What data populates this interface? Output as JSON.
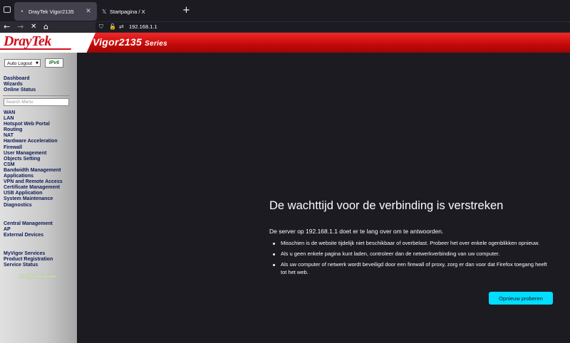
{
  "browser": {
    "tabs": [
      {
        "title": "DrayTek Vigor2135",
        "favicon": "dot-icon",
        "active": true
      },
      {
        "title": "Startpagina / X",
        "favicon": "x-logo-icon",
        "active": false
      }
    ],
    "url": "192.168.1.1"
  },
  "router": {
    "brand": "DrayTek",
    "model": "Vigor2135",
    "series": "Series",
    "auto_logout": "Auto Logout",
    "ipv6_badge": "IPv6",
    "search_placeholder": "Search Menu",
    "menu_top": [
      "Dashboard",
      "Wizards",
      "Online Status"
    ],
    "menu_main": [
      "WAN",
      "LAN",
      "Hotspot Web Portal",
      "Routing",
      "NAT",
      "Hardware Acceleration",
      "Firewall",
      "User Management",
      "Objects Setting",
      "CSM",
      "Bandwidth Management",
      "Applications",
      "VPN and Remote Access",
      "Certificate Management",
      "USB Application",
      "System Maintenance",
      "Diagnostics"
    ],
    "menu_central": [
      "Central Management",
      "AP",
      "External Devices"
    ],
    "menu_myvigor": [
      "MyVigor Services",
      "Product Registration",
      "Service Status"
    ],
    "rights": "All Rights Reserved."
  },
  "error": {
    "title": "De wachttijd voor de verbinding is verstreken",
    "lead": "De server op 192.168.1.1 doet er te lang over om te antwoorden.",
    "bullets": [
      "Misschien is de website tijdelijk niet beschikbaar of overbelast. Probeer het over enkele ogenblikken opnieuw.",
      "Als u geen enkele pagina kunt laden, controleer dan de netwerkverbinding van uw computer.",
      "Als uw computer of netwerk wordt beveiligd door een firewall of proxy, zorg er dan voor dat Firefox toegang heeft tot het web."
    ],
    "retry_label": "Opnieuw proberen"
  },
  "colors": {
    "error_bg": "#1c1b22",
    "banner_red": "#d10f1d",
    "retry_button": "#00ddff",
    "menu_text": "#0f1a55"
  }
}
